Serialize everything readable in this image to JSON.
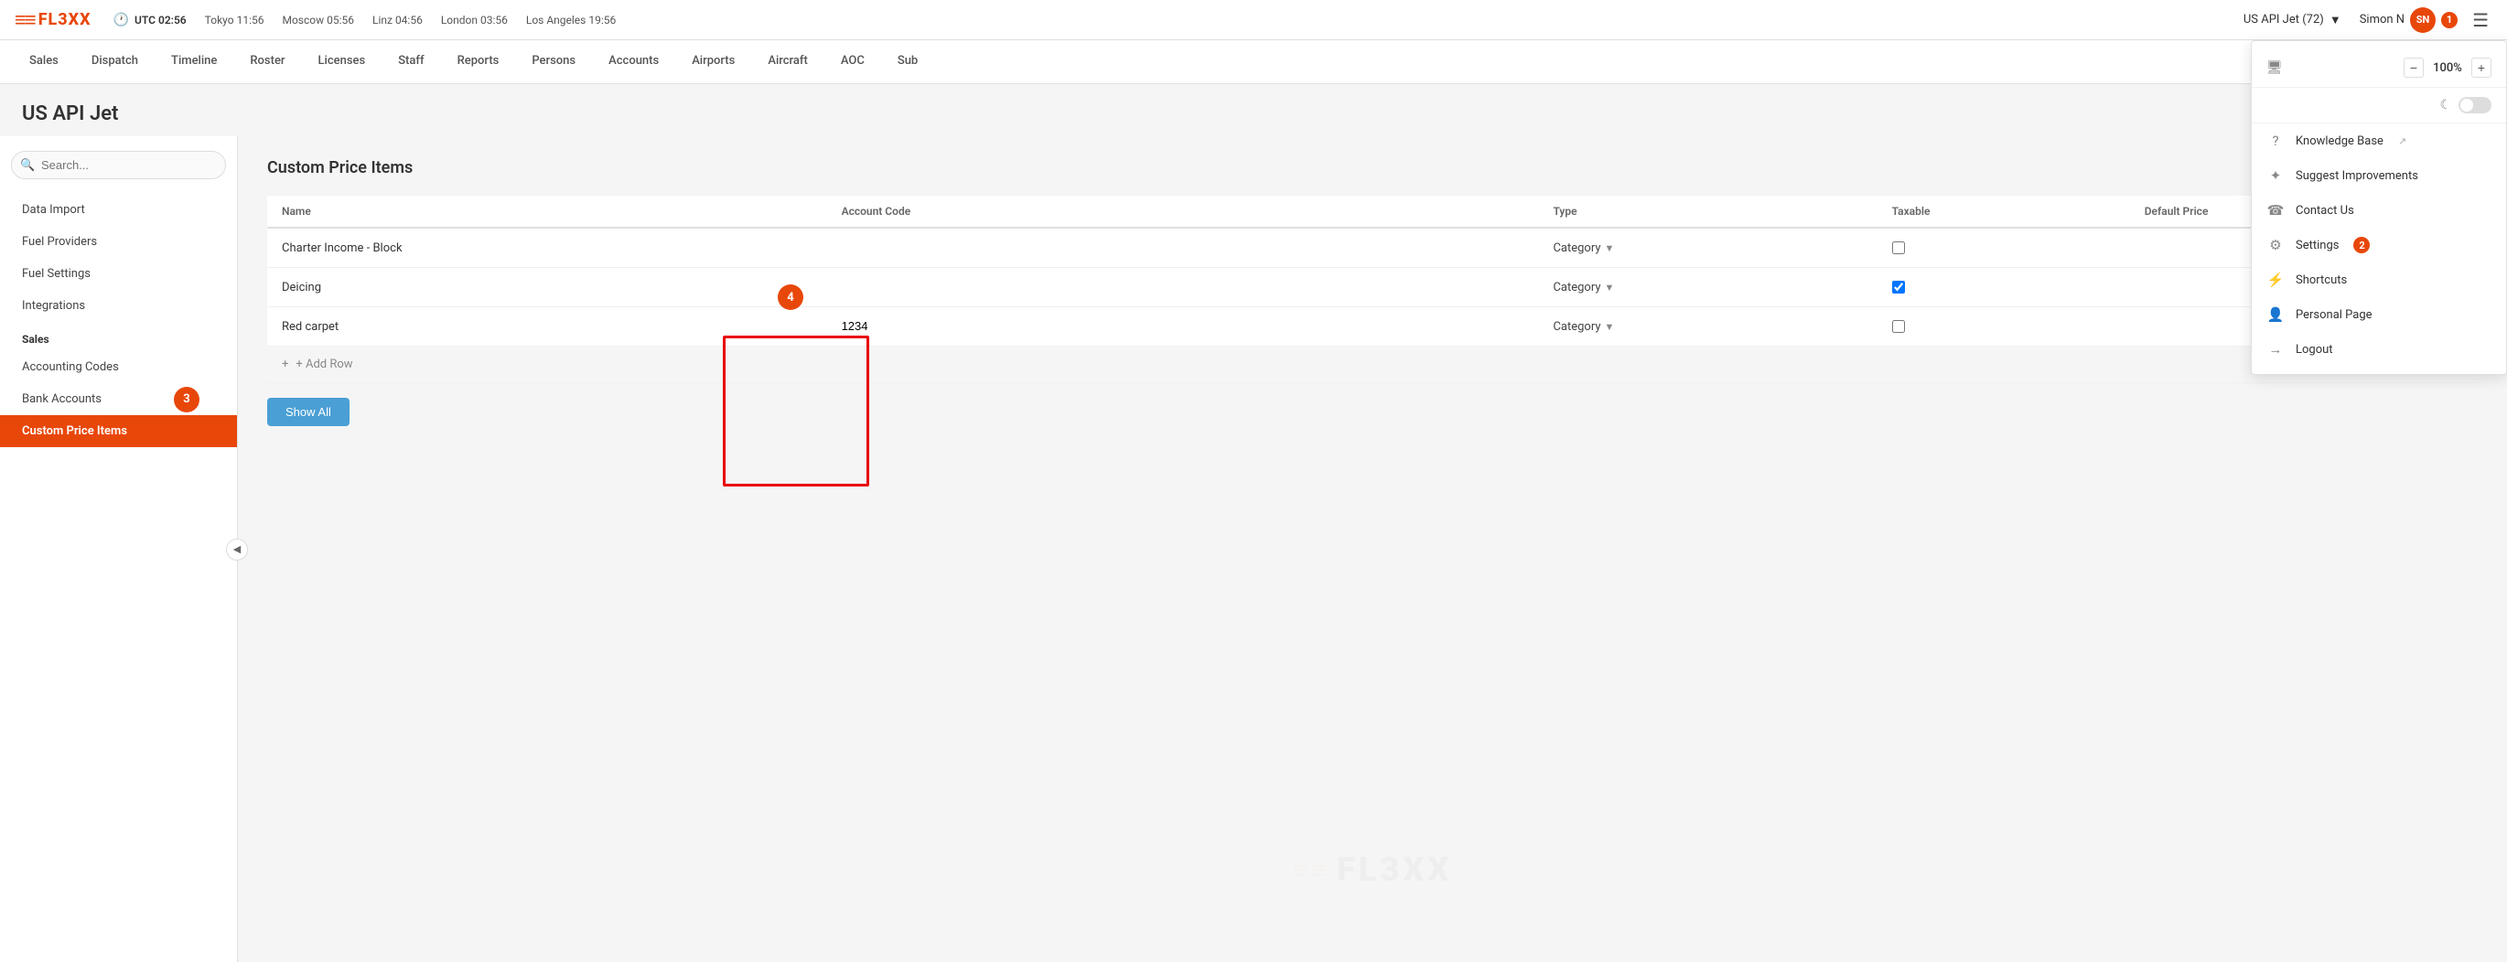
{
  "app": {
    "logo_icon": "≡≡",
    "logo_text": "FL3XX"
  },
  "topbar": {
    "utc_label": "UTC 02:56",
    "cities": [
      {
        "name": "Tokyo",
        "time": "11:56"
      },
      {
        "name": "Moscow",
        "time": "05:56"
      },
      {
        "name": "Linz",
        "time": "04:56"
      },
      {
        "name": "London",
        "time": "03:56"
      },
      {
        "name": "Los Angeles",
        "time": "19:56"
      }
    ],
    "company": "US API Jet (72)",
    "user_name": "Simon N",
    "user_initials": "SN",
    "notification_count": "1"
  },
  "nav": {
    "items": [
      {
        "label": "Sales",
        "active": false
      },
      {
        "label": "Dispatch",
        "active": false
      },
      {
        "label": "Timeline",
        "active": false
      },
      {
        "label": "Roster",
        "active": false
      },
      {
        "label": "Licenses",
        "active": false
      },
      {
        "label": "Staff",
        "active": false
      },
      {
        "label": "Reports",
        "active": false
      },
      {
        "label": "Persons",
        "active": false
      },
      {
        "label": "Accounts",
        "active": false
      },
      {
        "label": "Airports",
        "active": false
      },
      {
        "label": "Aircraft",
        "active": false
      },
      {
        "label": "AOC",
        "active": false
      },
      {
        "label": "Sub",
        "active": false
      }
    ]
  },
  "page": {
    "title": "US API Jet"
  },
  "sidebar": {
    "search_placeholder": "Search...",
    "items_top": [
      {
        "label": "Data Import"
      },
      {
        "label": "Fuel Providers"
      },
      {
        "label": "Fuel Settings"
      },
      {
        "label": "Integrations"
      }
    ],
    "section_sales": "Sales",
    "items_sales": [
      {
        "label": "Accounting Codes",
        "active": false
      },
      {
        "label": "Bank Accounts",
        "active": false
      },
      {
        "label": "Custom Price Items",
        "active": true
      }
    ]
  },
  "main": {
    "section_title": "Custom Price Items",
    "table": {
      "headers": [
        "Name",
        "Account Code",
        "Type",
        "Taxable",
        "Default Price"
      ],
      "rows": [
        {
          "name": "Charter Income - Block",
          "account_code": "",
          "type": "Category",
          "taxable": false,
          "default_price": ""
        },
        {
          "name": "Deicing",
          "account_code": "",
          "type": "Category",
          "taxable": true,
          "default_price": ""
        },
        {
          "name": "Red carpet",
          "account_code": "1234",
          "type": "Category",
          "taxable": false,
          "default_price": ""
        }
      ],
      "add_row_label": "+ Add Row"
    },
    "show_all_label": "Show All",
    "watermark_text": "FL3XX"
  },
  "dropdown_menu": {
    "zoom_minus": "−",
    "zoom_value": "100%",
    "zoom_plus": "+",
    "dark_mode_icon": "☾",
    "items": [
      {
        "icon": "?",
        "label": "Knowledge Base",
        "external": true,
        "badge": false
      },
      {
        "icon": "✦",
        "label": "Suggest Improvements",
        "external": false,
        "badge": false
      },
      {
        "icon": "☎",
        "label": "Contact Us",
        "external": false,
        "badge": false
      },
      {
        "icon": "⚙",
        "label": "Settings",
        "external": false,
        "badge": true,
        "badge_val": "2"
      },
      {
        "icon": "⚡",
        "label": "Shortcuts",
        "external": false,
        "badge": false
      },
      {
        "icon": "👤",
        "label": "Personal Page",
        "external": false,
        "badge": false
      },
      {
        "icon": "→",
        "label": "Logout",
        "external": false,
        "badge": false
      }
    ]
  },
  "badges": {
    "badge_4_label": "4",
    "badge_3_label": "3",
    "badge_2_label": "2",
    "badge_1_label": "1"
  }
}
